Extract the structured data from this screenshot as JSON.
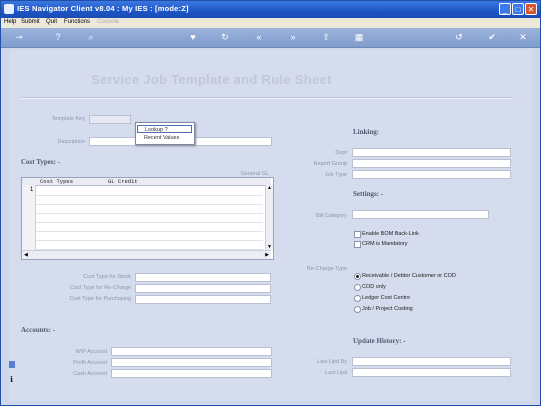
{
  "window": {
    "title": "IES Navigator Client v8.04 : My IES :      [mode:Z]",
    "controls": [
      "_",
      "□",
      "✕"
    ]
  },
  "menu": [
    {
      "label": "Help",
      "enabled": true
    },
    {
      "label": "Submit",
      "enabled": true
    },
    {
      "label": "Quit",
      "enabled": true
    },
    {
      "label": "Functions",
      "enabled": true
    },
    {
      "label": "Console",
      "enabled": false
    }
  ],
  "toolbar": {
    "icons": [
      "key-icon",
      "help-icon",
      "search-icon",
      "heart-icon",
      "refresh-icon",
      "rewind-icon",
      "fast-forward-icon",
      "upload-icon",
      "save-icon",
      "undo-icon",
      "check-icon",
      "close-icon"
    ],
    "glyphs": {
      "key": "⊸",
      "help": "?",
      "search": "⌕",
      "heart": "♥",
      "refresh": "↻",
      "rewind": "«",
      "forward": "»",
      "upload": "⇧",
      "save": "▦",
      "undo": "↺",
      "check": "✔",
      "close": "✕"
    }
  },
  "page": {
    "title": "Service Job Template and Rule Sheet",
    "template_key_label": "Template Key",
    "template_key_value": "",
    "description_label": "Description",
    "description_value": ""
  },
  "popup": {
    "items": [
      "Lookup ?",
      "Recent Values"
    ],
    "selected_index": 0
  },
  "cost_types": {
    "heading": "Cost Types: -",
    "general_label": "General GL",
    "columns": [
      "Cost Types",
      "GL Credit"
    ],
    "row_numbers": [
      "1"
    ],
    "rows": [
      [
        "",
        ""
      ],
      [
        "",
        ""
      ],
      [
        "",
        ""
      ],
      [
        "",
        ""
      ],
      [
        "",
        ""
      ],
      [
        "",
        ""
      ],
      [
        "",
        ""
      ]
    ],
    "stock_label": "Cost Type for Stock",
    "recharge_label": "Cost Type for Re-Charge",
    "purchasing_label": "Cost Type for Purchasing"
  },
  "accounts": {
    "heading": "Accounts: -",
    "wip_label": "WIP Account",
    "profit_label": "Profit Account",
    "cash_label": "Cash Account"
  },
  "linking": {
    "heading": "Linking:",
    "dept_label": "Dept",
    "report_group_label": "Report Group",
    "job_type_label": "Job Type"
  },
  "settings": {
    "heading": "Settings: -",
    "bill_category_label": "Bill Category",
    "enable_bom_label": "Enable BOM Back-Link",
    "enable_bom_checked": false,
    "crm_mandatory_label": "CRM is Mandatory",
    "crm_mandatory_checked": false,
    "recharge_type_label": "Re-Charge Type",
    "recharge_options": [
      "Receivable / Debtor Customer or COD",
      "COD only",
      "Ledger Cost Centre",
      "Job / Project Costing"
    ],
    "recharge_selected": 0
  },
  "update_history": {
    "heading": "Update History: -",
    "last_upd_by_label": "Last Upd By",
    "last_upd_label": "Last Upd"
  },
  "colors": {
    "titlebar": "#1e56c7",
    "background": "#d4dcee",
    "toolbar": "#8aa4d2"
  }
}
